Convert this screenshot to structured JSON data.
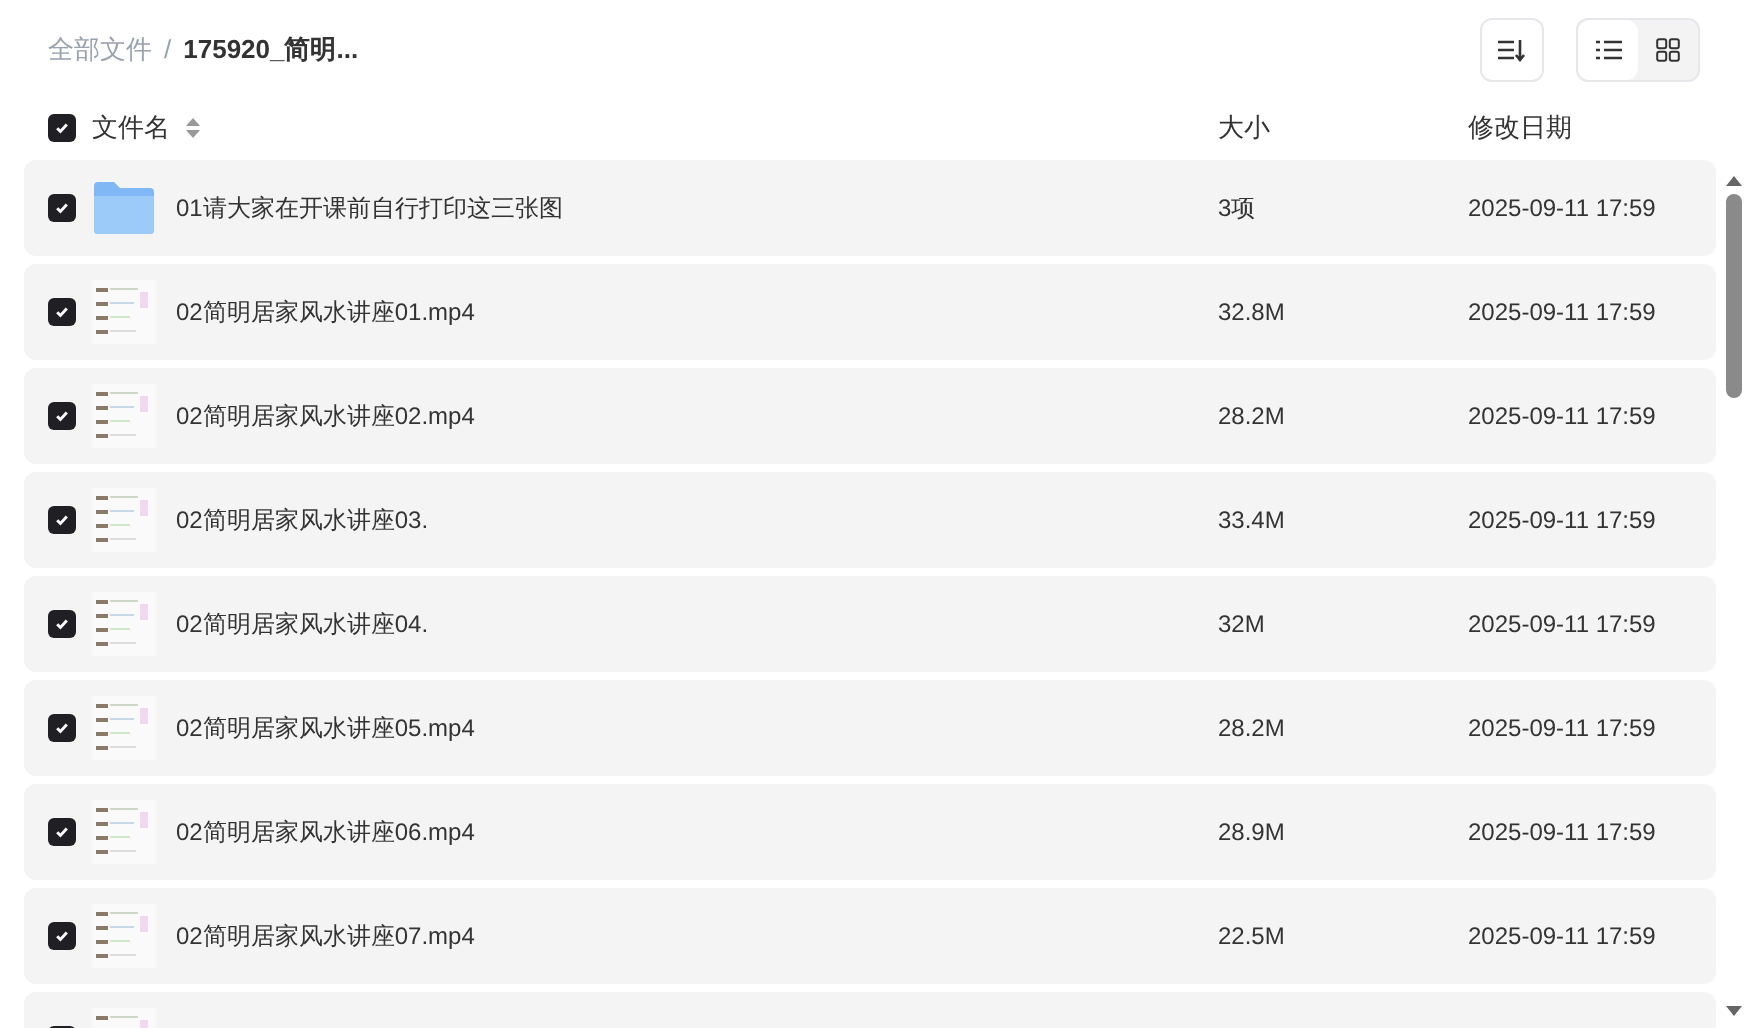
{
  "breadcrumb": {
    "root": "全部文件",
    "separator": "/",
    "current": "175920_简明..."
  },
  "view_modes": [
    {
      "kind": "list",
      "selected": true
    },
    {
      "kind": "grid",
      "selected": false
    }
  ],
  "select_all": {
    "checked": true
  },
  "columns": [
    "文件名",
    "大小",
    "修改日期"
  ],
  "rows": [
    {
      "kind": "folder",
      "checked": true,
      "name": "01请大家在开课前自行打印这三张图",
      "size": "3项",
      "modified": "2025-09-11 17:59"
    },
    {
      "kind": "video",
      "checked": true,
      "name": "02简明居家风水讲座01.mp4",
      "size": "32.8M",
      "modified": "2025-09-11 17:59"
    },
    {
      "kind": "video",
      "checked": true,
      "name": "02简明居家风水讲座02.mp4",
      "size": "28.2M",
      "modified": "2025-09-11 17:59"
    },
    {
      "kind": "video",
      "checked": true,
      "name": "02简明居家风水讲座03.",
      "size": "33.4M",
      "modified": "2025-09-11 17:59"
    },
    {
      "kind": "video",
      "checked": true,
      "name": "02简明居家风水讲座04.",
      "size": "32M",
      "modified": "2025-09-11 17:59"
    },
    {
      "kind": "video",
      "checked": true,
      "name": "02简明居家风水讲座05.mp4",
      "size": "28.2M",
      "modified": "2025-09-11 17:59"
    },
    {
      "kind": "video",
      "checked": true,
      "name": "02简明居家风水讲座06.mp4",
      "size": "28.9M",
      "modified": "2025-09-11 17:59"
    },
    {
      "kind": "video",
      "checked": true,
      "name": "02简明居家风水讲座07.mp4",
      "size": "22.5M",
      "modified": "2025-09-11 17:59"
    },
    {
      "kind": "video",
      "checked": true
    }
  ]
}
